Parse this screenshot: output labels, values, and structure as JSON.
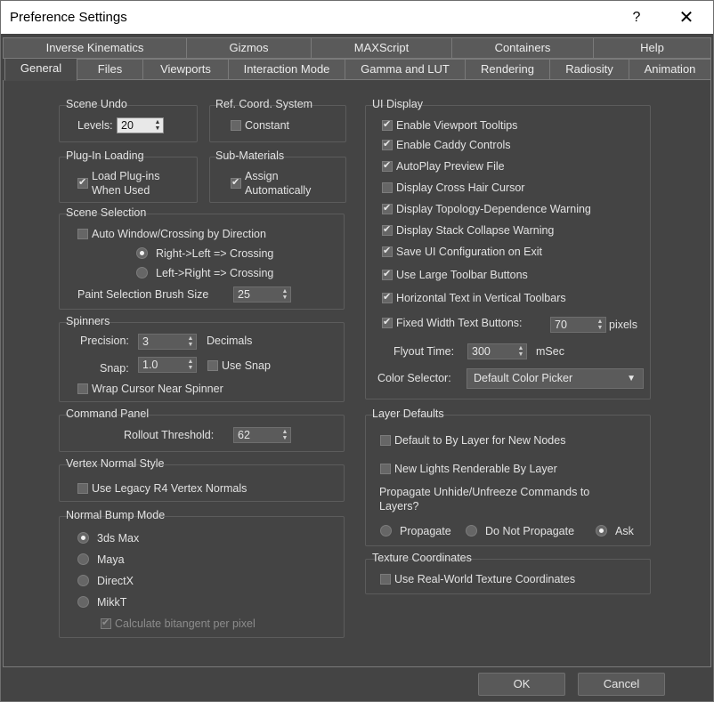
{
  "window": {
    "title": "Preference Settings",
    "help_label": "?",
    "close_label": "✕"
  },
  "tabs_row1": [
    "Inverse Kinematics",
    "Gizmos",
    "MAXScript",
    "Containers",
    "Help"
  ],
  "tabs_row2": [
    "General",
    "Files",
    "Viewports",
    "Interaction Mode",
    "Gamma and LUT",
    "Rendering",
    "Radiosity",
    "Animation"
  ],
  "active_tab": "General",
  "scene_undo": {
    "title": "Scene Undo",
    "levels_label": "Levels:",
    "levels_value": "20"
  },
  "ref_coord": {
    "title": "Ref. Coord. System",
    "constant_label": "Constant",
    "constant_checked": false
  },
  "plugin_loading": {
    "title": "Plug-In Loading",
    "load_label_1": "Load Plug-ins",
    "load_label_2": "When Used",
    "load_checked": true
  },
  "sub_materials": {
    "title": "Sub-Materials",
    "assign_label_1": "Assign",
    "assign_label_2": "Automatically",
    "assign_checked": true
  },
  "scene_selection": {
    "title": "Scene Selection",
    "auto_window_label": "Auto Window/Crossing by Direction",
    "auto_window_checked": false,
    "rl_label": "Right->Left => Crossing",
    "lr_label": "Left->Right => Crossing",
    "selected": "Right->Left => Crossing",
    "brush_label": "Paint Selection Brush Size",
    "brush_value": "25"
  },
  "spinners": {
    "title": "Spinners",
    "precision_label": "Precision:",
    "precision_value": "3",
    "decimals_label": "Decimals",
    "snap_label": "Snap:",
    "snap_value": "1.0",
    "use_snap_label": "Use Snap",
    "use_snap_checked": false,
    "wrap_label": "Wrap Cursor Near Spinner",
    "wrap_checked": false
  },
  "command_panel": {
    "title": "Command Panel",
    "rollout_label": "Rollout Threshold:",
    "rollout_value": "62"
  },
  "vertex_normal": {
    "title": "Vertex Normal Style",
    "legacy_label": "Use Legacy R4 Vertex Normals",
    "legacy_checked": false
  },
  "normal_bump": {
    "title": "Normal Bump Mode",
    "options": [
      "3ds Max",
      "Maya",
      "DirectX",
      "MikkT"
    ],
    "selected": "3ds Max",
    "bitangent_label": "Calculate bitangent per pixel",
    "bitangent_checked": true
  },
  "ui_display": {
    "title": "UI Display",
    "items": [
      {
        "label": "Enable Viewport Tooltips",
        "checked": true
      },
      {
        "label": "Enable Caddy Controls",
        "checked": true
      },
      {
        "label": "AutoPlay Preview File",
        "checked": true
      },
      {
        "label": "Display Cross Hair Cursor",
        "checked": false
      },
      {
        "label": "Display Topology-Dependence Warning",
        "checked": true
      },
      {
        "label": "Display Stack Collapse Warning",
        "checked": true
      },
      {
        "label": "Save UI Configuration on Exit",
        "checked": true
      },
      {
        "label": "Use Large Toolbar Buttons",
        "checked": true
      },
      {
        "label": "Horizontal Text in Vertical Toolbars",
        "checked": true
      }
    ],
    "fixed_width_label": "Fixed Width Text Buttons:",
    "fixed_width_checked": true,
    "fixed_width_value": "70",
    "pixels_label": "pixels",
    "flyout_label": "Flyout Time:",
    "flyout_value": "300",
    "msec_label": "mSec",
    "color_selector_label": "Color Selector:",
    "color_selector_value": "Default Color Picker"
  },
  "layer_defaults": {
    "title": "Layer Defaults",
    "default_bylayer_label": "Default to By Layer for New Nodes",
    "default_bylayer_checked": false,
    "new_lights_label": "New Lights Renderable By Layer",
    "new_lights_checked": false,
    "propagate_text_1": "Propagate Unhide/Unfreeze Commands to",
    "propagate_text_2": "Layers?",
    "options": [
      "Propagate",
      "Do Not Propagate",
      "Ask"
    ],
    "selected": "Ask"
  },
  "texture_coords": {
    "title": "Texture Coordinates",
    "realworld_label": "Use Real-World Texture Coordinates",
    "realworld_checked": false
  },
  "buttons": {
    "ok": "OK",
    "cancel": "Cancel"
  }
}
